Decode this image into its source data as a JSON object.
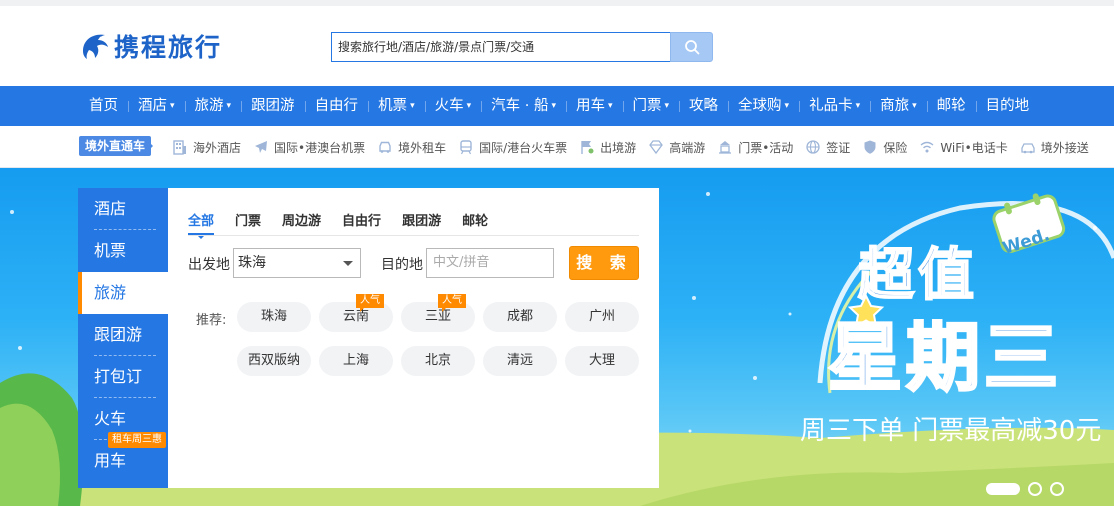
{
  "header": {
    "logo_text": "携程旅行",
    "search_placeholder": "搜索旅行地/酒店/旅游/景点门票/交通"
  },
  "main_nav": {
    "items": [
      {
        "label": "首页",
        "dropdown": false
      },
      {
        "label": "酒店",
        "dropdown": true
      },
      {
        "label": "旅游",
        "dropdown": true
      },
      {
        "label": "跟团游",
        "dropdown": false
      },
      {
        "label": "自由行",
        "dropdown": false
      },
      {
        "label": "机票",
        "dropdown": true
      },
      {
        "label": "火车",
        "dropdown": true
      },
      {
        "label": "汽车 · 船",
        "dropdown": true
      },
      {
        "label": "用车",
        "dropdown": true
      },
      {
        "label": "门票",
        "dropdown": true
      },
      {
        "label": "攻略",
        "dropdown": false
      },
      {
        "label": "全球购",
        "dropdown": true
      },
      {
        "label": "礼品卡",
        "dropdown": true
      },
      {
        "label": "商旅",
        "dropdown": true
      },
      {
        "label": "邮轮",
        "dropdown": false
      },
      {
        "label": "目的地",
        "dropdown": false
      }
    ],
    "caret": "▾"
  },
  "sub_nav": {
    "tag": "境外直通车",
    "items": [
      {
        "label": "海外酒店",
        "icon": "hotel-icon"
      },
      {
        "label": "国际•港澳台机票",
        "icon": "plane-icon"
      },
      {
        "label": "境外租车",
        "icon": "car-icon"
      },
      {
        "label": "国际/港台火车票",
        "icon": "train-icon"
      },
      {
        "label": "出境游",
        "icon": "flag-icon"
      },
      {
        "label": "高端游",
        "icon": "diamond-icon"
      },
      {
        "label": "门票•活动",
        "icon": "ticket-icon"
      },
      {
        "label": "签证",
        "icon": "globe-icon"
      },
      {
        "label": "保险",
        "icon": "shield-icon"
      },
      {
        "label": "WiFi•电话卡",
        "icon": "wifi-icon"
      },
      {
        "label": "境外接送",
        "icon": "transfer-icon"
      }
    ]
  },
  "side_menu": {
    "items": [
      {
        "label": "酒店"
      },
      {
        "label": "机票"
      },
      {
        "label": "旅游",
        "active": true
      },
      {
        "label": "跟团游"
      },
      {
        "label": "打包订"
      },
      {
        "label": "火车"
      },
      {
        "label": "用车",
        "badge": "租车周三惠"
      }
    ]
  },
  "search_panel": {
    "tabs": [
      "全部",
      "门票",
      "周边游",
      "自由行",
      "跟团游",
      "邮轮"
    ],
    "active_tab": "全部",
    "from_label": "出发地",
    "from_value": "珠海",
    "to_label": "目的地",
    "to_placeholder": "中文/拼音",
    "search_button": "搜 索",
    "recommend_label": "推荐:",
    "recommendations": [
      {
        "label": "珠海"
      },
      {
        "label": "云南",
        "hot": "人气"
      },
      {
        "label": "三亚",
        "hot": "人气"
      },
      {
        "label": "成都"
      },
      {
        "label": "广州"
      },
      {
        "label": "西双版纳"
      },
      {
        "label": "上海"
      },
      {
        "label": "北京"
      },
      {
        "label": "清远"
      },
      {
        "label": "大理"
      }
    ]
  },
  "banner": {
    "title_line1": "超值",
    "title_line2": "星期三",
    "calendar_text": "Wed.",
    "subtitle": "周三下单 门票最高减30元",
    "carousel_active": 1,
    "carousel_count": 3
  },
  "colors": {
    "brand_blue": "#2577e3",
    "accent_orange": "#ff9a0e",
    "banner_sky": "#2db1f6"
  }
}
